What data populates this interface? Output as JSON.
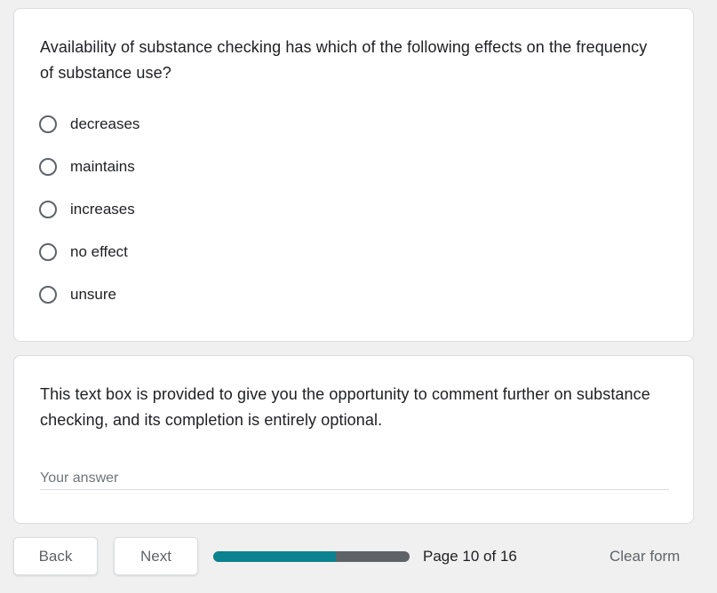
{
  "question1": {
    "text": "Availability of substance checking has which of the following effects on the frequency of substance use?",
    "options": [
      {
        "label": "decreases",
        "selected": false
      },
      {
        "label": "maintains",
        "selected": false
      },
      {
        "label": "increases",
        "selected": false
      },
      {
        "label": "no effect",
        "selected": false
      },
      {
        "label": "unsure",
        "selected": false
      }
    ]
  },
  "question2": {
    "text": "This text box is provided to give you the opportunity to comment further on substance checking, and its completion is entirely optional.",
    "answer_placeholder": "Your answer",
    "answer_value": ""
  },
  "navigation": {
    "back_label": "Back",
    "next_label": "Next",
    "current_page": 10,
    "total_pages": 16,
    "page_indicator": "Page 10 of 16",
    "progress_fraction": 0.625,
    "clear_label": "Clear form"
  },
  "colors": {
    "progress_fill": "#0b8290",
    "progress_track": "#5f6368",
    "background": "#f0f0f0"
  }
}
